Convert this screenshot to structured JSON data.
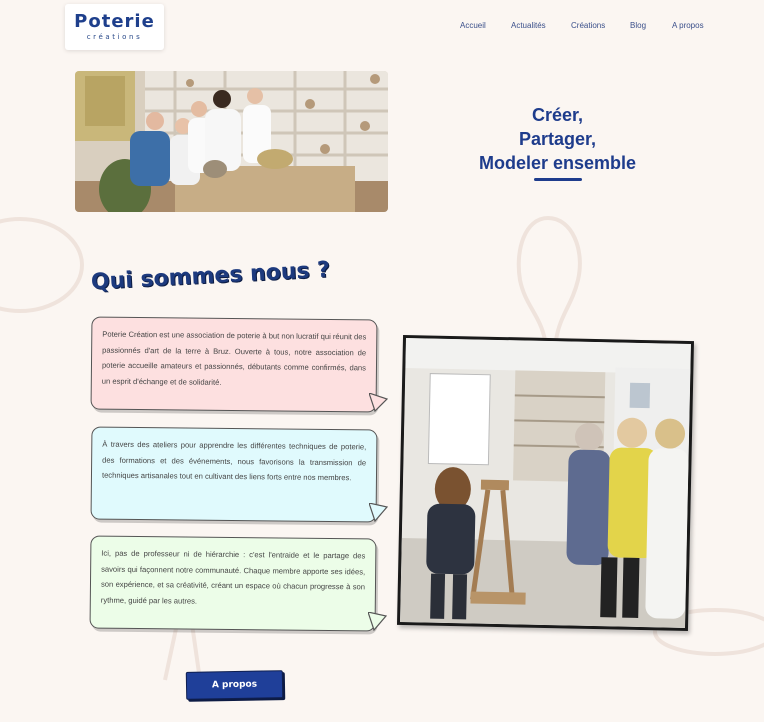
{
  "header": {
    "logo": {
      "brand": "Poterie",
      "subtitle": "créations"
    },
    "nav": [
      {
        "label": "Accueil"
      },
      {
        "label": "Actualités"
      },
      {
        "label": "Créations"
      },
      {
        "label": "Blog"
      },
      {
        "label": "A propos"
      }
    ]
  },
  "hero": {
    "tagline": [
      "Créer,",
      "Partager,",
      "Modeler ensemble"
    ]
  },
  "about": {
    "title": "Qui sommes nous ?",
    "paragraphs": [
      "Poterie Création est une association de poterie à but non lucratif qui réunit des passionnés d'art de la terre à Bruz. Ouverte à tous, notre association de poterie accueille amateurs et passionnés, débutants comme confirmés, dans un esprit d'échange et de solidarité.",
      "À travers des ateliers pour apprendre les différentes techniques de poterie, des formations et des événements, nous favorisons la transmission de techniques artisanales tout en cultivant des liens forts entre nos membres.",
      "Ici, pas de professeur ni de hiérarchie : c'est l'entraide et le partage des savoirs qui façonnent notre communauté. Chaque membre apporte ses idées, son expérience, et sa créativité, créant un espace où chacun progresse à son rythme, guidé par les autres."
    ],
    "button_label": "A propos"
  },
  "colors": {
    "brand_blue": "#1e3c8c",
    "background": "#fbf6f2",
    "bubble_pink": "#fde0e0",
    "bubble_cyan": "#e0fafd",
    "bubble_green": "#ecfde8"
  }
}
